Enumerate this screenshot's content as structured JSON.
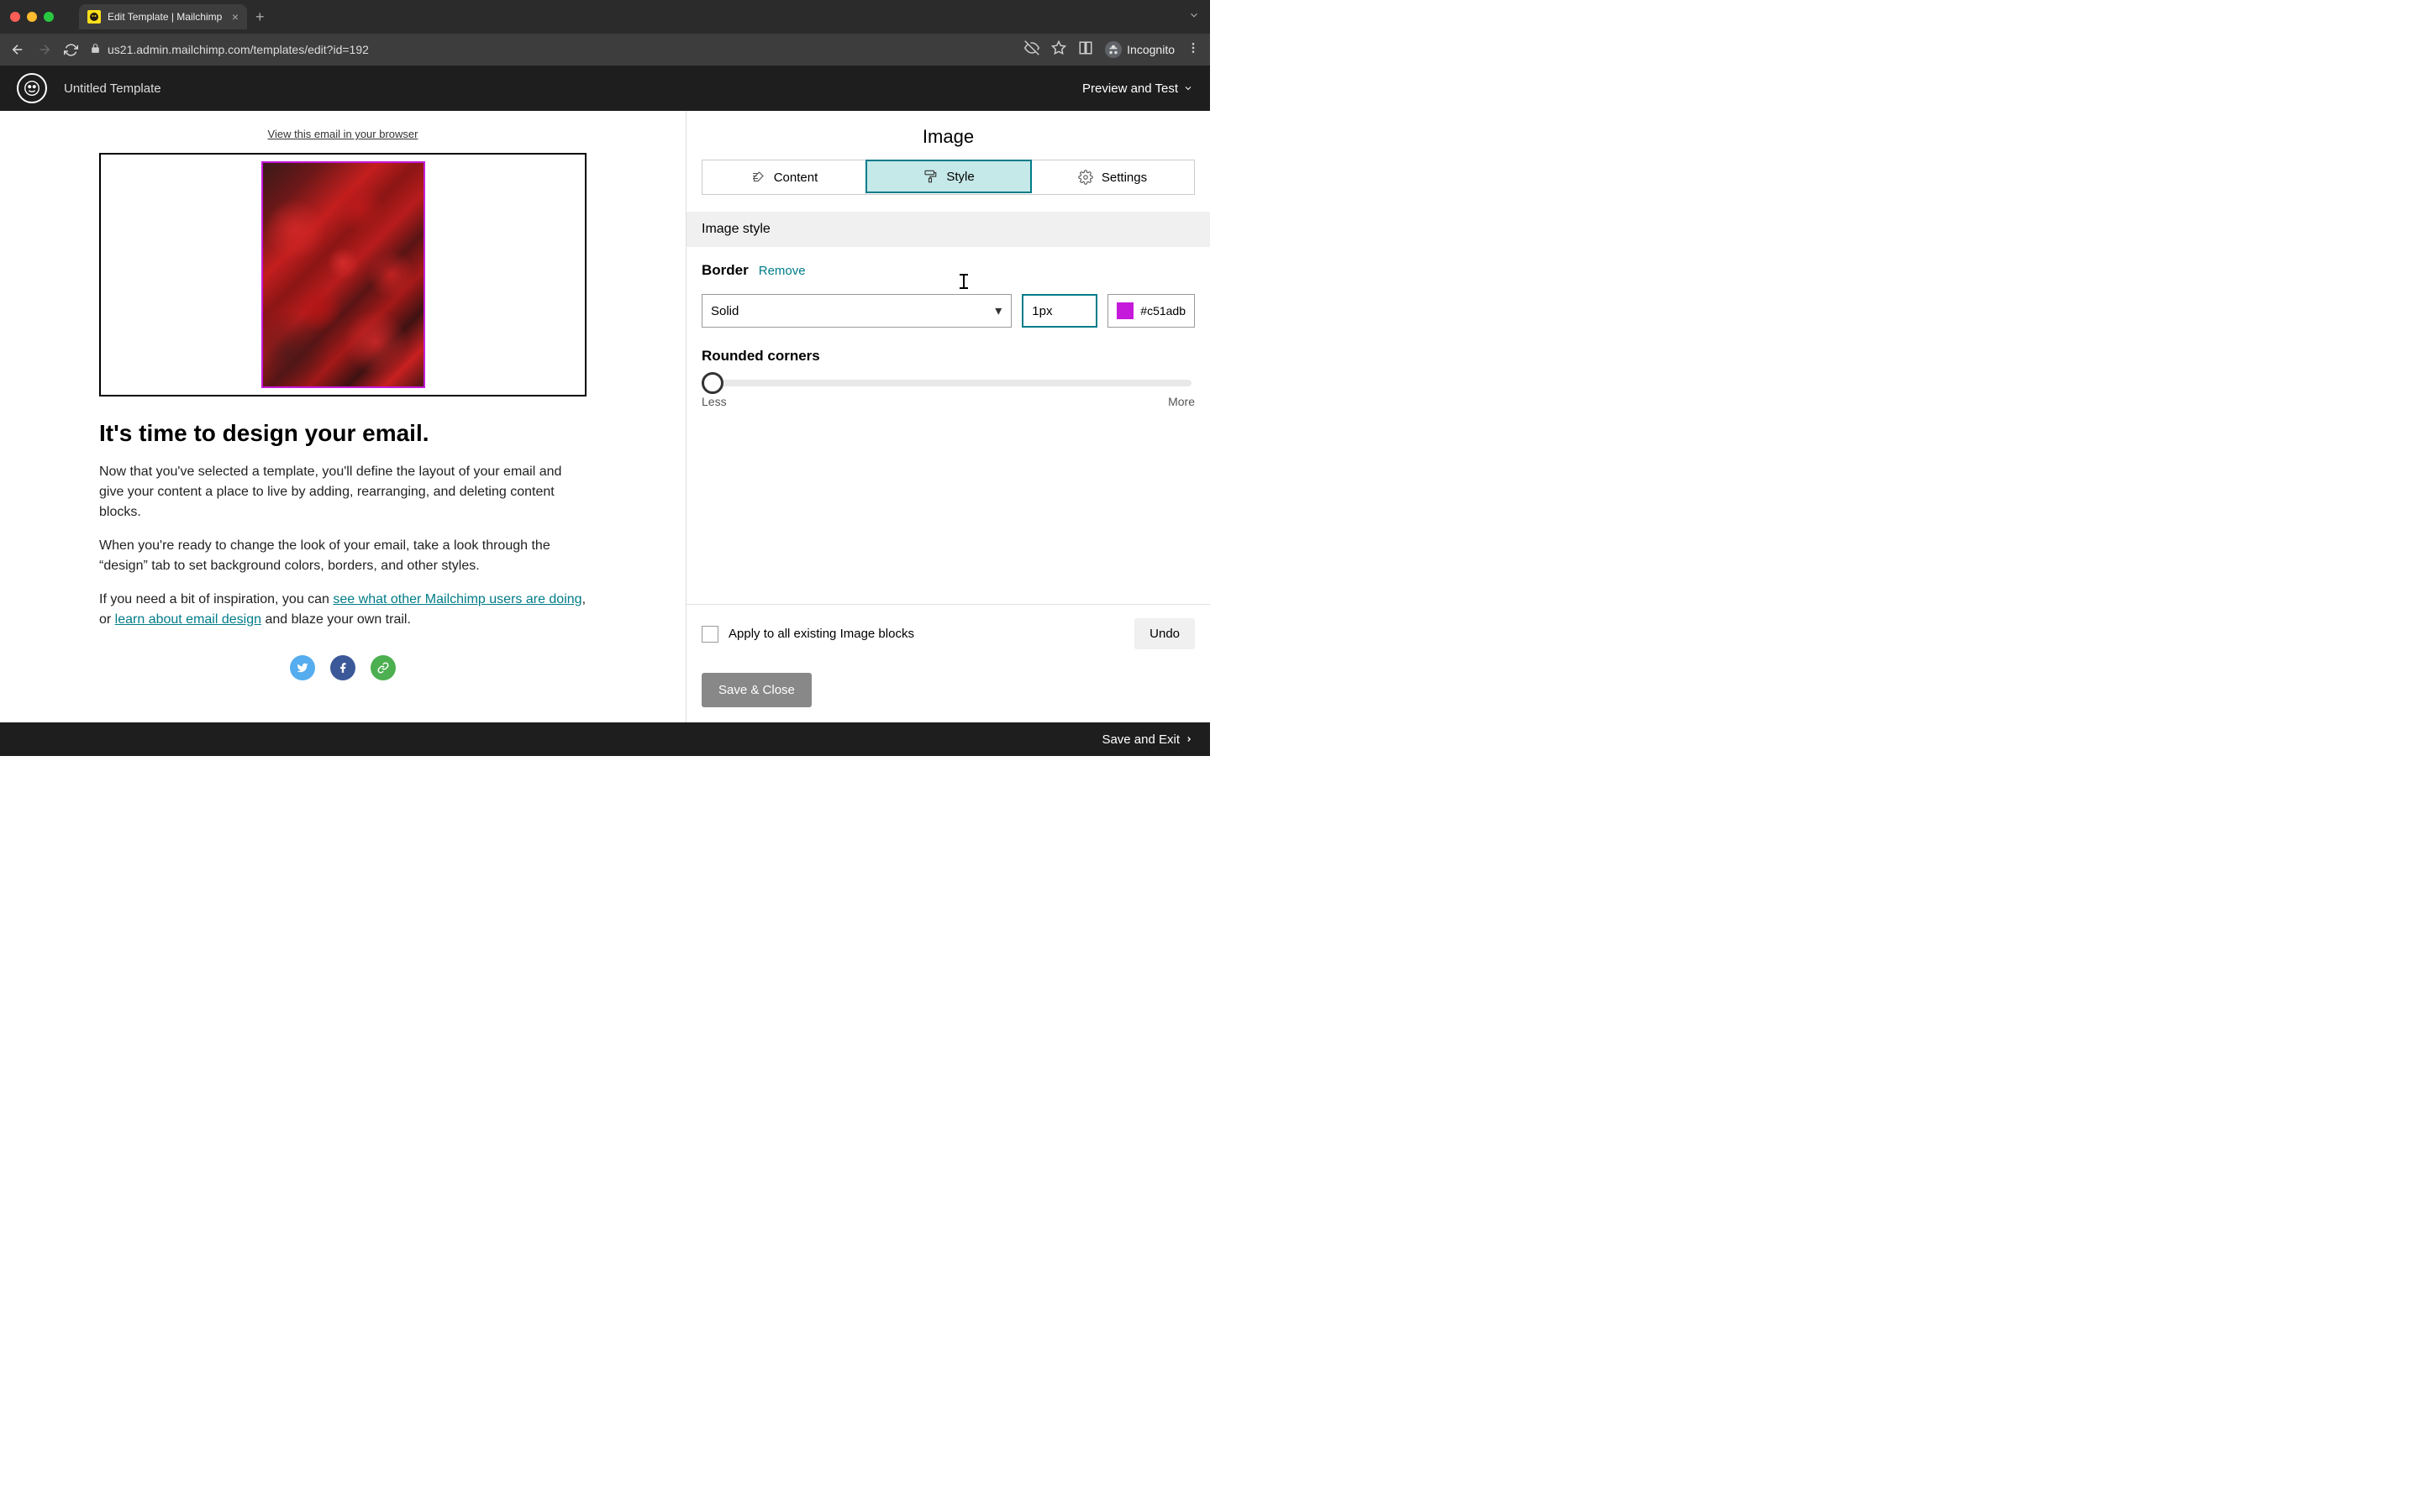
{
  "browser": {
    "tab_title": "Edit Template | Mailchimp",
    "url": "us21.admin.mailchimp.com/templates/edit?id=192",
    "incognito_label": "Incognito"
  },
  "header": {
    "template_name": "Untitled Template",
    "preview_test": "Preview and Test"
  },
  "canvas": {
    "view_in_browser": "View this email in your browser",
    "heading": "It's time to design your email.",
    "para1": "Now that you've selected a template, you'll define the layout of your email and give your content a place to live by adding, rearranging, and deleting content blocks.",
    "para2": "When you're ready to change the look of your email, take a look through the “design” tab to set background colors, borders, and other styles.",
    "para3_pre": "If you need a bit of inspiration, you can ",
    "para3_link1": "see what other Mailchimp users are doing",
    "para3_mid": ", or ",
    "para3_link2": "learn about email design",
    "para3_post": " and blaze your own trail."
  },
  "panel": {
    "title": "Image",
    "tabs": {
      "content": "Content",
      "style": "Style",
      "settings": "Settings"
    },
    "section": "Image style",
    "border_label": "Border",
    "remove": "Remove",
    "style_value": "Solid",
    "width_value": "1px",
    "color_value": "#c51adb",
    "rounded_label": "Rounded corners",
    "slider_less": "Less",
    "slider_more": "More",
    "apply_all": "Apply to all existing Image blocks",
    "undo": "Undo",
    "save_close": "Save & Close"
  },
  "footer": {
    "save_exit": "Save and Exit"
  }
}
